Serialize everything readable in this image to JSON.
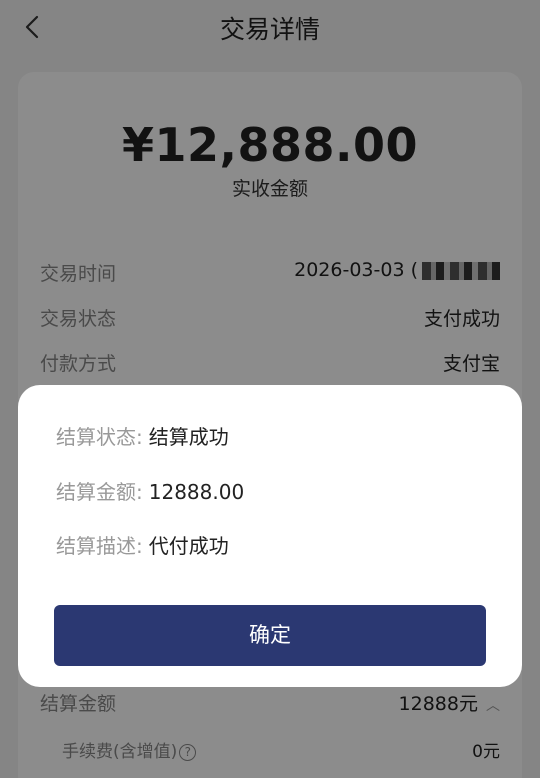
{
  "header": {
    "title": "交易详情"
  },
  "summary": {
    "amount": "¥12,888.00",
    "amount_label": "实收金额"
  },
  "details": [
    {
      "label": "交易时间",
      "value": "2026-03-03 ("
    },
    {
      "label": "交易状态",
      "value": "支付成功"
    },
    {
      "label": "付款方式",
      "value": "支付宝"
    }
  ],
  "settle_amount": {
    "label": "结算金额",
    "value": "12888元"
  },
  "fee": {
    "label": "手续费(含增值)",
    "value": "0元",
    "help": "?"
  },
  "modal": {
    "rows": [
      {
        "label": "结算状态:",
        "value": "结算成功"
      },
      {
        "label": "结算金额:",
        "value": "12888.00"
      },
      {
        "label": "结算描述:",
        "value": "代付成功"
      }
    ],
    "confirm_label": "确定"
  },
  "colors": {
    "primary": "#2b3872",
    "overlay": "rgba(0,0,0,0.45)"
  }
}
